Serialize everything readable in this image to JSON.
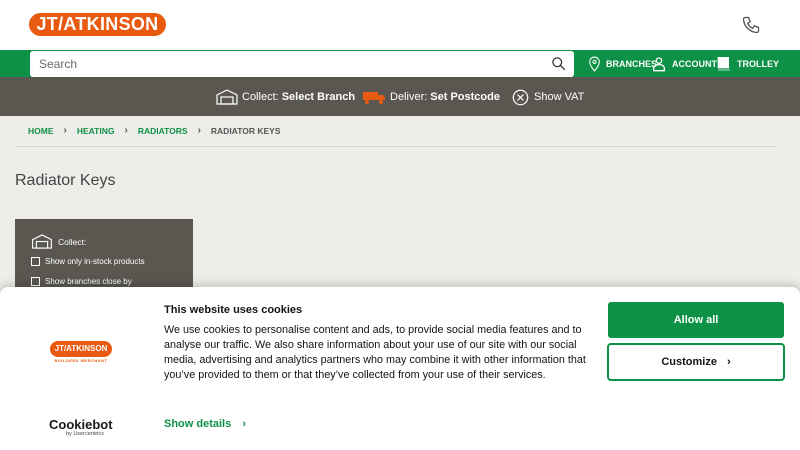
{
  "header": {
    "logo_text": "JT/ATKINSON",
    "phone_icon": "phone-icon"
  },
  "search": {
    "placeholder": "Search",
    "icon": "search-icon"
  },
  "nav": {
    "branches": "BRANCHES",
    "account": "ACCOUNT",
    "trolley": "TROLLEY"
  },
  "service_bar": {
    "collect_label": "Collect:",
    "collect_value": "Select Branch",
    "deliver_label": "Deliver:",
    "deliver_value": "Set Postcode",
    "vat_label": "Show VAT"
  },
  "breadcrumb": [
    "HOME",
    "HEATING",
    "RADIATORS",
    "RADIATOR KEYS"
  ],
  "page": {
    "title": "Radiator Keys"
  },
  "filter": {
    "collect_label": "Collect:",
    "options": [
      "Show only in-stock products",
      "Show branches close by"
    ]
  },
  "cookie": {
    "title": "This website uses cookies",
    "body": "We use cookies to personalise content and ads, to provide social media features and to analyse our traffic. We also share information about your use of our site with our social media, advertising and analytics partners who may combine it with other information that you’ve provided to them or that they’ve collected from your use of their services.",
    "show_details": "Show details",
    "allow_all": "Allow all",
    "customize": "Customize",
    "logo_text": "JT/ATKINSON",
    "logo_sub": "BUILDERS MERCHANT",
    "cookiebot": "Cookiebot",
    "cookiebot_sub": "by Usercentrics"
  },
  "colors": {
    "brand_orange": "#e85a0f",
    "brand_green": "#0d9146",
    "dark_gray": "#59574f"
  }
}
